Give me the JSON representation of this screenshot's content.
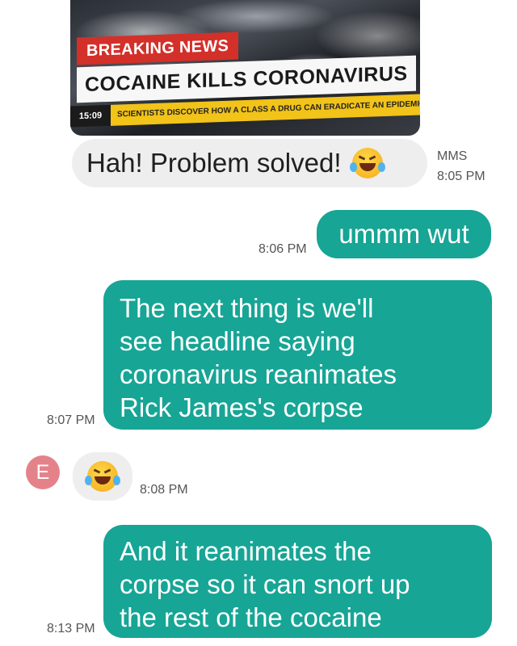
{
  "mms_image": {
    "tag": "BREAKING NEWS",
    "headline": "COCAINE KILLS CORONAVIRUS",
    "ticker_time": "15:09",
    "ticker_text": "SCIENTISTS DISCOVER HOW A CLASS A DRUG CAN ERADICATE AN EPIDEMIC"
  },
  "messages": [
    {
      "text": "Hah!  Problem solved!",
      "emoji": "rolling-on-floor-laughing",
      "meta_type": "MMS",
      "time": "8:05 PM"
    },
    {
      "text": "ummm wut",
      "time": "8:06 PM"
    },
    {
      "lines": [
        "The next thing is we'll",
        "see headline saying",
        "coronavirus reanimates",
        "Rick James's corpse"
      ],
      "time": "8:07 PM"
    },
    {
      "avatar_letter": "E",
      "emoji": "rolling-on-floor-laughing",
      "time": "8:08 PM"
    },
    {
      "lines": [
        "And it reanimates the",
        "corpse so it can snort up",
        "the rest of the cocaine"
      ],
      "time": "8:13 PM"
    }
  ],
  "colors": {
    "outgoing_bubble": "#17a595",
    "incoming_bubble": "#eeeeee",
    "avatar": "#e4828a",
    "breaking_red": "#d3302a",
    "ticker_yellow": "#f2c318"
  }
}
